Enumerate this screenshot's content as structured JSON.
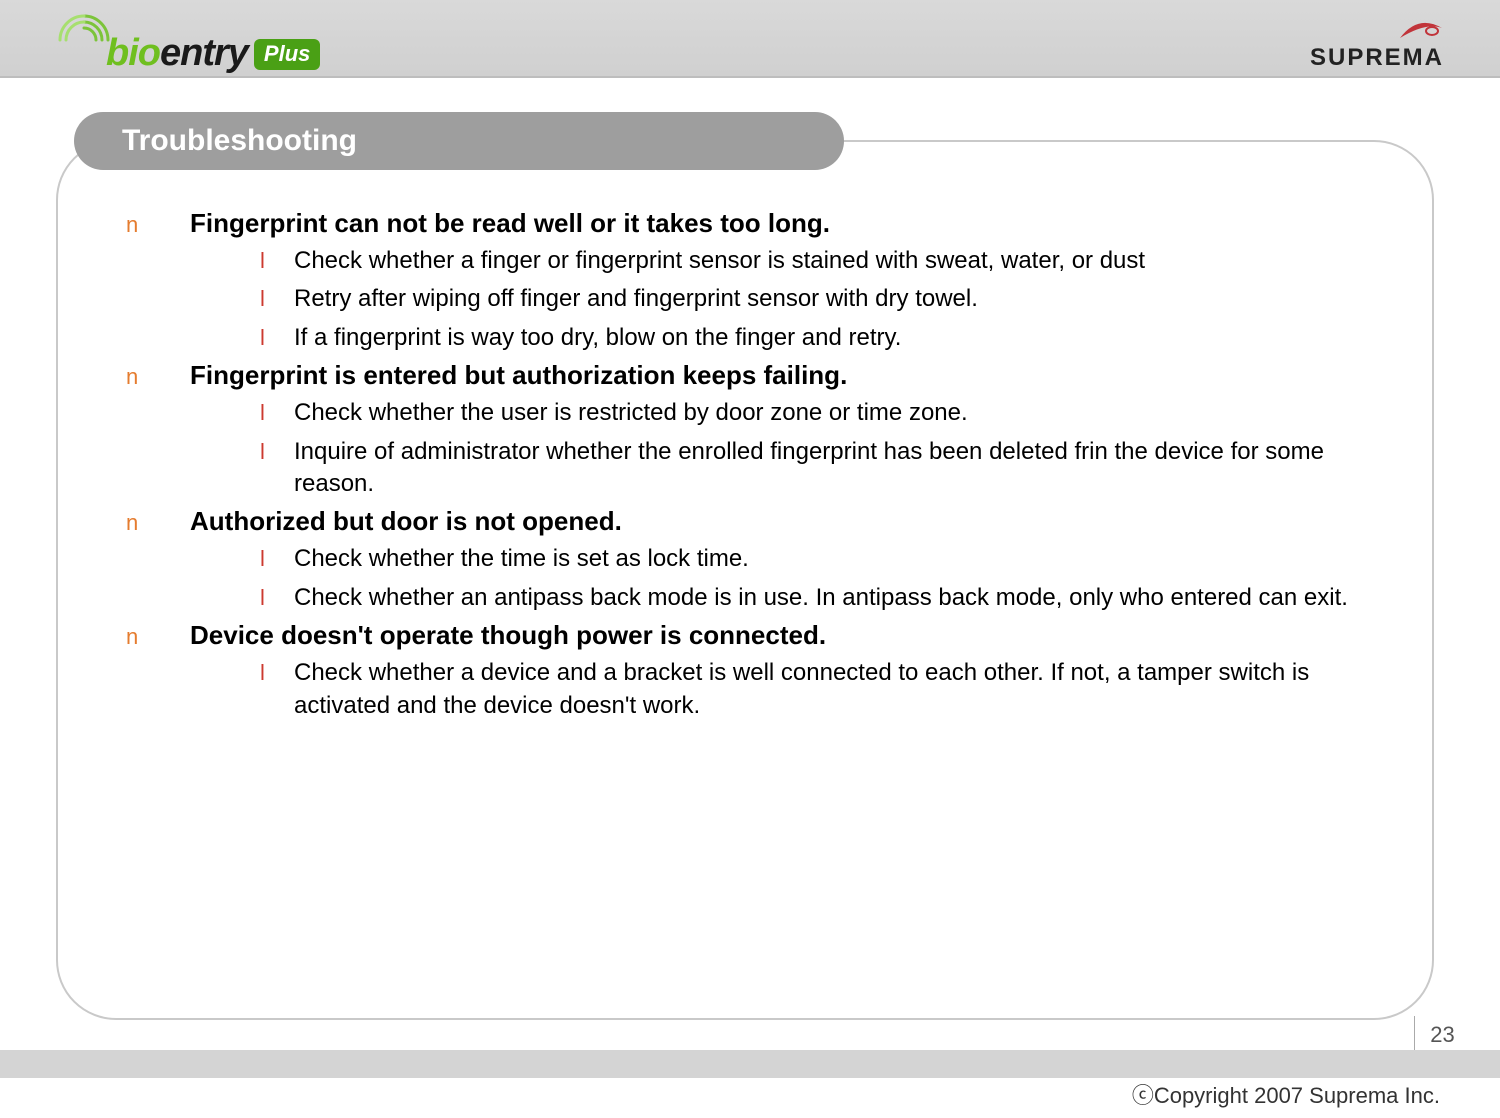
{
  "header": {
    "logo_left_bio": "bio",
    "logo_left_entry": "entry",
    "logo_left_plus": "Plus",
    "logo_right": "SUPREMA"
  },
  "title": "Troubleshooting",
  "sections": [
    {
      "heading": "Fingerprint can not be read well or it takes too long.",
      "items": [
        "Check whether a finger or fingerprint sensor is stained with sweat, water, or dust",
        "Retry after wiping off finger and fingerprint sensor with dry towel.",
        "If a fingerprint is way too dry, blow on the finger and retry."
      ]
    },
    {
      "heading": "Fingerprint is entered but authorization keeps failing.",
      "items": [
        "Check whether the user is restricted by door zone or time zone.",
        "Inquire of administrator whether the enrolled fingerprint has been deleted frin the device for some reason."
      ]
    },
    {
      "heading": "Authorized but door is not opened.",
      "items": [
        "Check whether the time is set as lock time.",
        "Check whether an antipass back mode is in use. In antipass back mode, only who entered can exit."
      ]
    },
    {
      "heading": "Device doesn't operate though power is connected.",
      "items": [
        "Check whether a device and a bracket is well connected to each other. If not, a tamper switch is activated and the device doesn't work."
      ]
    }
  ],
  "bullets": {
    "topic": "n",
    "item": "l"
  },
  "footer": {
    "page": "23",
    "copyright": "ⓒCopyright 2007 Suprema Inc."
  }
}
